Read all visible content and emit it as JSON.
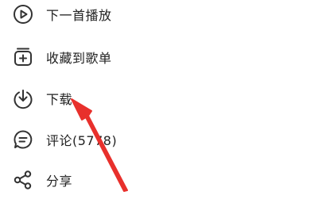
{
  "menu": {
    "items": [
      {
        "label": "下一首播放",
        "icon": "play-next-icon"
      },
      {
        "label": "收藏到歌单",
        "icon": "add-to-playlist-icon"
      },
      {
        "label": "下载",
        "icon": "download-icon"
      },
      {
        "label": "评论(5778)",
        "icon": "comment-icon"
      },
      {
        "label": "分享",
        "icon": "share-icon"
      }
    ]
  },
  "annotation": {
    "arrow_color": "#e8302c",
    "points_to": "下载"
  },
  "colors": {
    "text": "#222222",
    "icon": "#333333",
    "background": "#ffffff"
  }
}
